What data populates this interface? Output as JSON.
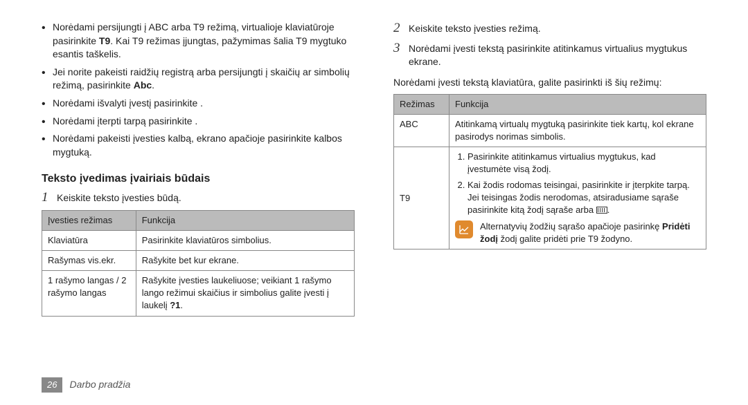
{
  "left": {
    "bullets": [
      {
        "pre": "Norėdami persijungti į ABC arba T9 režimą, virtualioje klaviatūroje pasirinkite ",
        "b": "T9",
        "post": ". Kai T9 režimas įjungtas, pažymimas šalia T9 mygtuko esantis taškelis."
      },
      {
        "pre": "Jei norite pakeisti raidžių registrą arba persijungti į skaičių ar simbolių režimą, pasirinkite ",
        "b": "Abc",
        "post": "."
      },
      {
        "pre": "Norėdami išvalyti įvestį pasirinkite        .",
        "b": "",
        "post": ""
      },
      {
        "pre": "Norėdami įterpti tarpą pasirinkite        .",
        "b": "",
        "post": ""
      },
      {
        "pre": "Norėdami pakeisti įvesties kalbą, ekrano apačioje pasirinkite kalbos mygtuką.",
        "b": "",
        "post": ""
      }
    ],
    "heading": "Teksto įvedimas įvairiais būdais",
    "step1_num": "1",
    "step1_text": "Keiskite teksto įvesties būdą.",
    "table": {
      "h1": "Įvesties režimas",
      "h2": "Funkcija",
      "r1c1": "Klaviatūra",
      "r1c2": "Pasirinkite klaviatūros simbolius.",
      "r2c1": "Rašymas vis.ekr.",
      "r2c2": "Rašykite bet kur ekrane.",
      "r3c1": "1 rašymo langas / 2 rašymo langas",
      "r3c2a": "Rašykite įvesties laukeliuose; veikiant 1 rašymo lango režimui skaičius ir simbolius galite įvesti į laukelį ",
      "r3c2b": "?1",
      "r3c2c": "."
    }
  },
  "right": {
    "step2_num": "2",
    "step2_text": "Keiskite teksto įvesties režimą.",
    "step3_num": "3",
    "step3_text": "Norėdami įvesti tekstą pasirinkite atitinkamus virtualius mygtukus ekrane.",
    "intro": "Norėdami įvesti tekstą klaviatūra, galite pasirinkti iš šių režimų:",
    "table": {
      "h1": "Režimas",
      "h2": "Funkcija",
      "r1c1": "ABC",
      "r1c2": "Atitinkamą virtualų mygtuką pasirinkite tiek kartų, kol ekrane pasirodys norimas simbolis.",
      "r2c1": "T9",
      "li1": "Pasirinkite atitinkamus virtualius mygtukus, kad įvestumėte visą žodį.",
      "li2a": "Kai žodis rodomas teisingai, pasirinkite        ir įterpkite tarpą. Jei teisingas žodis nerodomas, atsiradusiame sąraše pasirinkite kitą žodį sąraše arba ",
      "li2b": ".",
      "note_a": "Alternatyvių žodžių sąrašo apačioje pasirinkę ",
      "note_b": "Pridėti žodį",
      "note_c": " žodį galite pridėti prie T9 žodyno."
    }
  },
  "footer": {
    "page": "26",
    "section": "Darbo pradžia"
  }
}
